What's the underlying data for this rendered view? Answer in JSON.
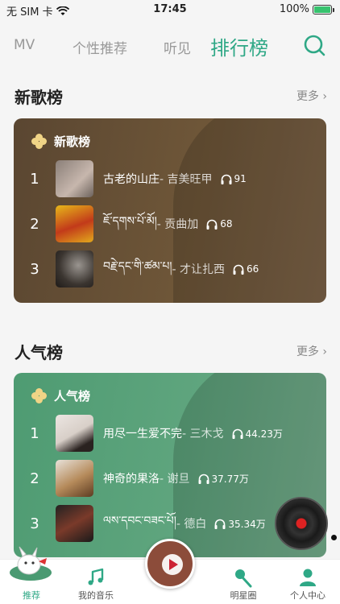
{
  "status": {
    "carrier": "无 SIM 卡",
    "time": "17:45",
    "battery": "100%",
    "battery_level": 1.0
  },
  "topnav": {
    "tabs": [
      "MV",
      "个性推荐",
      "听见",
      "排行榜"
    ],
    "active_tab": "排行榜",
    "search_icon": "search-icon"
  },
  "sections": {
    "new": {
      "title": "新歌榜",
      "more": "更多",
      "card_title": "新歌榜",
      "songs": [
        {
          "rank": "1",
          "title": "古老的山庄",
          "artist": " - 吉美旺甲",
          "plays": "91"
        },
        {
          "rank": "2",
          "title": "ཇོ་དགས་པོ་མོ།",
          "artist": " - 贡曲加",
          "plays": "68"
        },
        {
          "rank": "3",
          "title": "བརྗེ་དང་གི་ཚམ་པ།",
          "artist": " - 才让扎西",
          "plays": "66"
        }
      ]
    },
    "popular": {
      "title": "人气榜",
      "more": "更多",
      "card_title": "人气榜",
      "songs": [
        {
          "rank": "1",
          "title": "用尽一生爱不完",
          "artist": " - 三木戈",
          "plays": "44.23万"
        },
        {
          "rank": "2",
          "title": "神奇的果洛",
          "artist": " - 谢旦",
          "plays": "37.77万"
        },
        {
          "rank": "3",
          "title": "ལས་དབང་བཟང་པོ།",
          "artist": " - 德白",
          "plays": "35.34万"
        }
      ]
    }
  },
  "tabbar": {
    "items": [
      "推荐",
      "我的音乐",
      "明星圈",
      "个人中心"
    ],
    "active": "推荐"
  },
  "colors": {
    "accent": "#2fa886",
    "new_card": "#6e5638",
    "popular_card": "#5fa57e"
  }
}
